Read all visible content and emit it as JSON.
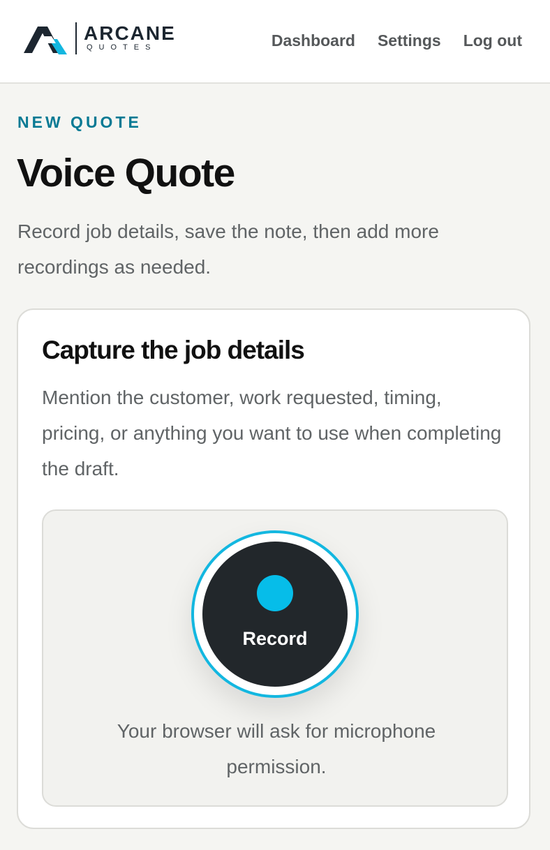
{
  "header": {
    "logo_word": "ARCANE",
    "logo_sub": "QUOTES",
    "nav": [
      "Dashboard",
      "Settings",
      "Log out"
    ]
  },
  "page": {
    "eyebrow": "NEW QUOTE",
    "title": "Voice Quote",
    "intro": "Record job details, save the note, then add more recordings as needed."
  },
  "card": {
    "title": "Capture the job details",
    "text": "Mention the customer, work requested, timing, pricing, or anything you want to use when completing the draft.",
    "record_label": "Record",
    "permission_text": "Your browser will ask for microphone permission."
  },
  "colors": {
    "accent": "#06bde9",
    "eyebrow": "#087a94",
    "button": "#22272b"
  }
}
